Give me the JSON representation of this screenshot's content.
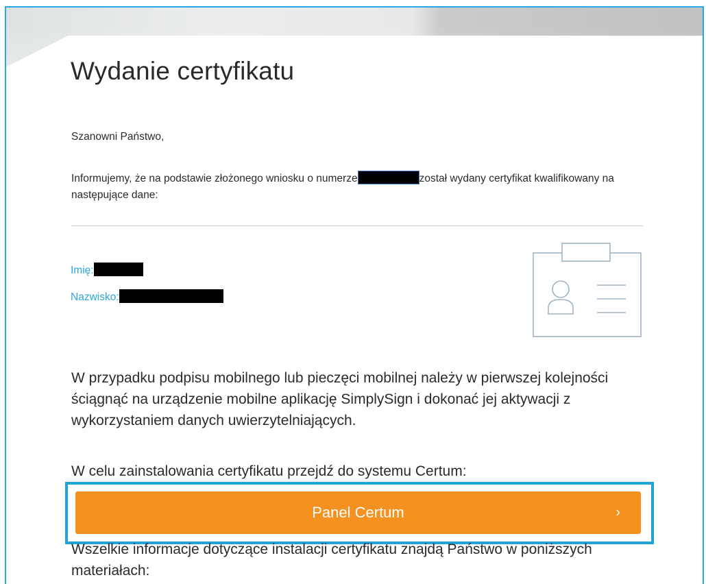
{
  "email": {
    "title": "Wydanie certyfikatu",
    "greeting": "Szanowni Państwo,",
    "info_before": "Informujemy, że na podstawie złożonego wniosku o numerze",
    "info_after": "został wydany certyfikat kwalifikowany na następujące dane:",
    "fields": {
      "first_name_label": "Imię:",
      "last_name_label": "Nazwisko:"
    },
    "mobile_note": "W przypadku podpisu mobilnego lub pieczęci mobilnej należy w pierwszej kolejności ściągnąć na urządzenie mobilne aplikację SimplySign i dokonać jej aktywacji z wykorzystaniem danych uwierzytelniających.",
    "install_note": "W celu zainstalowania certyfikatu przejdź do systemu Certum:",
    "cta": {
      "label": "Panel Certum",
      "chevron": "›"
    },
    "materials_note": "Wszelkie informacje dotyczące instalacji certyfikatu znajdą Państwo w poniższych materiałach:"
  },
  "colors": {
    "accent_orange": "#f5911e",
    "label_blue": "#2aa6df",
    "highlight_blue": "#1fa3d9"
  },
  "icons": {
    "id_card": "id-badge-icon"
  }
}
